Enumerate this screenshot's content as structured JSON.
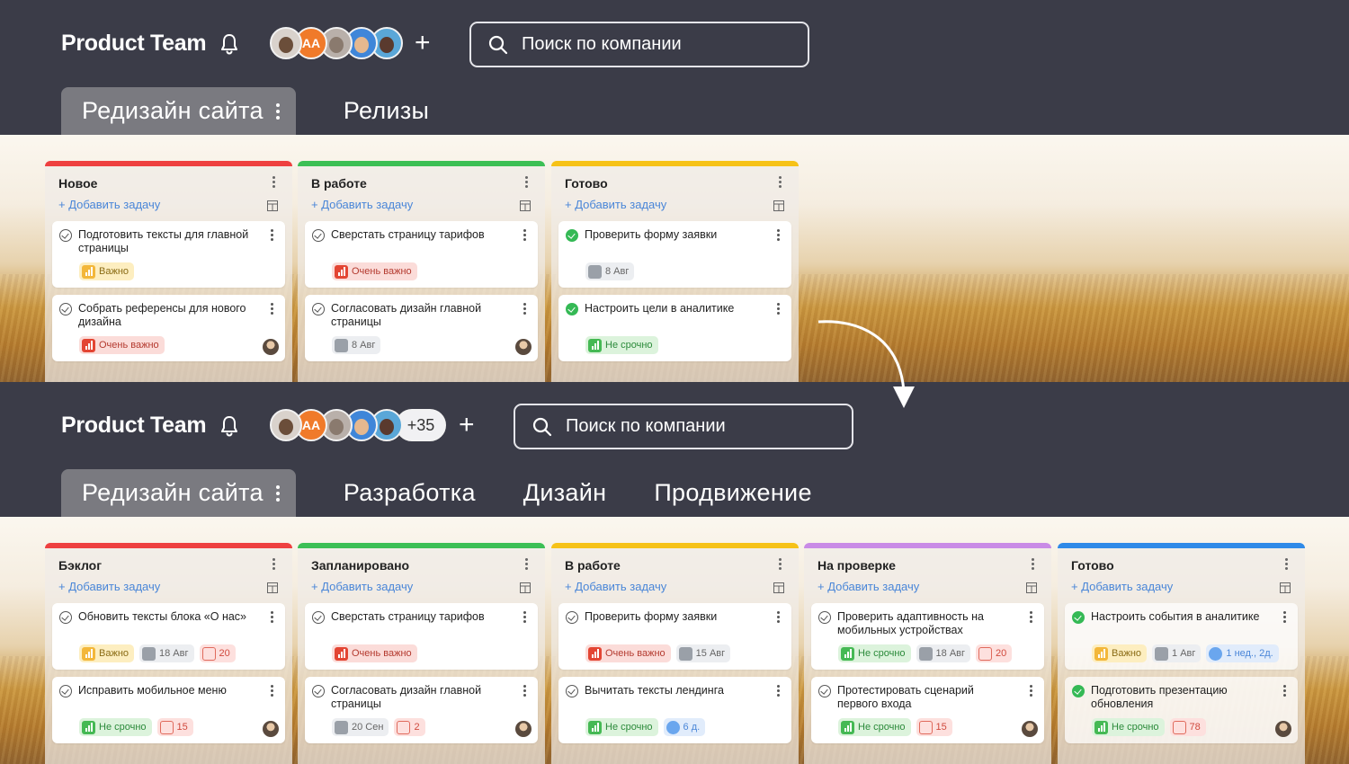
{
  "colors": {
    "red": "#ee4040",
    "green": "#3cbf55",
    "yellow": "#f6c218",
    "purple": "#c98be6",
    "blue": "#2f8ae8",
    "link": "#4a86d8"
  },
  "top": {
    "team_title": "Product Team",
    "avatars": [
      "user-photo",
      "AA",
      "user-photo",
      "user-photo",
      "user-photo"
    ],
    "add_member": "+",
    "search_placeholder": "Поиск по компании",
    "tabs": [
      {
        "label": "Редизайн сайта",
        "active": true
      },
      {
        "label": "Релизы",
        "active": false
      }
    ],
    "columns": [
      {
        "title": "Новое",
        "add_label": "+ Добавить задачу",
        "color": "red",
        "cards": [
          {
            "title": "Подготовить тексты для главной страницы",
            "tags": [
              {
                "type": "imp",
                "text": "Важно"
              }
            ]
          },
          {
            "title": "Собрать референсы для нового дизайна",
            "tags": [
              {
                "type": "vimp",
                "text": "Очень важно"
              }
            ],
            "assignee": true
          }
        ]
      },
      {
        "title": "В работе",
        "add_label": "+ Добавить задачу",
        "color": "green",
        "cards": [
          {
            "title": "Сверстать страницу тарифов",
            "tags": [
              {
                "type": "vimp",
                "text": "Очень важно"
              }
            ]
          },
          {
            "title": "Согласовать дизайн главной страницы",
            "tags": [
              {
                "type": "date",
                "text": "8 Авг"
              }
            ],
            "assignee": true
          }
        ]
      },
      {
        "title": "Готово",
        "add_label": "+ Добавить задачу",
        "color": "yellow",
        "cards": [
          {
            "title": "Проверить форму заявки",
            "done": true,
            "tags": [
              {
                "type": "date",
                "text": "8 Авг"
              }
            ]
          },
          {
            "title": "Настроить цели в аналитике",
            "done": true,
            "tags": [
              {
                "type": "nurg",
                "text": "Не срочно"
              }
            ]
          }
        ]
      }
    ]
  },
  "bottom": {
    "team_title": "Product Team",
    "avatars": [
      "user-photo",
      "AA",
      "user-photo",
      "user-photo",
      "user-photo"
    ],
    "more_count": "+35",
    "add_member": "+",
    "search_placeholder": "Поиск по компании",
    "tabs": [
      {
        "label": "Редизайн сайта",
        "active": true
      },
      {
        "label": "Разработка",
        "active": false
      },
      {
        "label": "Дизайн",
        "active": false
      },
      {
        "label": "Продвижение",
        "active": false
      }
    ],
    "columns": [
      {
        "title": "Бэклог",
        "add_label": "+ Добавить задачу",
        "color": "red",
        "cards": [
          {
            "title": "Обновить тексты блока «О нас»",
            "tags": [
              {
                "type": "imp",
                "text": "Важно"
              },
              {
                "type": "date",
                "text": "18 Авг"
              },
              {
                "type": "cmt",
                "text": "20"
              }
            ]
          },
          {
            "title": "Исправить мобильное меню",
            "tags": [
              {
                "type": "nurg",
                "text": "Не срочно"
              },
              {
                "type": "cmt",
                "text": "15"
              }
            ],
            "assignee": true
          }
        ]
      },
      {
        "title": "Запланировано",
        "add_label": "+ Добавить задачу",
        "color": "green",
        "cards": [
          {
            "title": "Сверстать страницу тарифов",
            "tags": [
              {
                "type": "vimp",
                "text": "Очень важно"
              }
            ]
          },
          {
            "title": "Согласовать дизайн главной страницы",
            "tags": [
              {
                "type": "date",
                "text": "20 Сен"
              },
              {
                "type": "cmt",
                "text": "2"
              }
            ],
            "assignee": true
          }
        ]
      },
      {
        "title": "В работе",
        "add_label": "+ Добавить задачу",
        "color": "yellow",
        "cards": [
          {
            "title": "Проверить форму заявки",
            "tags": [
              {
                "type": "vimp",
                "text": "Очень важно"
              },
              {
                "type": "date",
                "text": "15 Авг"
              }
            ]
          },
          {
            "title": "Вычитать тексты лендинга",
            "tags": [
              {
                "type": "nurg",
                "text": "Не срочно"
              },
              {
                "type": "time",
                "text": "6 д."
              }
            ]
          }
        ]
      },
      {
        "title": "На проверке",
        "add_label": "+ Добавить задачу",
        "color": "purple",
        "cards": [
          {
            "title": "Проверить адаптивность на мобильных устройствах",
            "tags": [
              {
                "type": "nurg",
                "text": "Не срочно"
              },
              {
                "type": "date",
                "text": "18 Авг"
              },
              {
                "type": "cmt",
                "text": "20"
              }
            ]
          },
          {
            "title": "Протестировать сценарий первого входа",
            "tags": [
              {
                "type": "nurg",
                "text": "Не срочно"
              },
              {
                "type": "cmt",
                "text": "15"
              }
            ],
            "assignee": true
          }
        ]
      },
      {
        "title": "Готово",
        "add_label": "+ Добавить задачу",
        "color": "blue",
        "cards": [
          {
            "title": "Настроить события в аналитике",
            "done": true,
            "faded": true,
            "tags": [
              {
                "type": "imp",
                "text": "Важно"
              },
              {
                "type": "date",
                "text": "1 Авг"
              },
              {
                "type": "time",
                "text": "1 нед., 2д."
              }
            ]
          },
          {
            "title": "Подготовить презентацию обновления",
            "done": true,
            "faded": true,
            "tags": [
              {
                "type": "nurg",
                "text": "Не срочно"
              },
              {
                "type": "cmt",
                "text": "78"
              }
            ],
            "assignee": true
          }
        ]
      }
    ]
  }
}
